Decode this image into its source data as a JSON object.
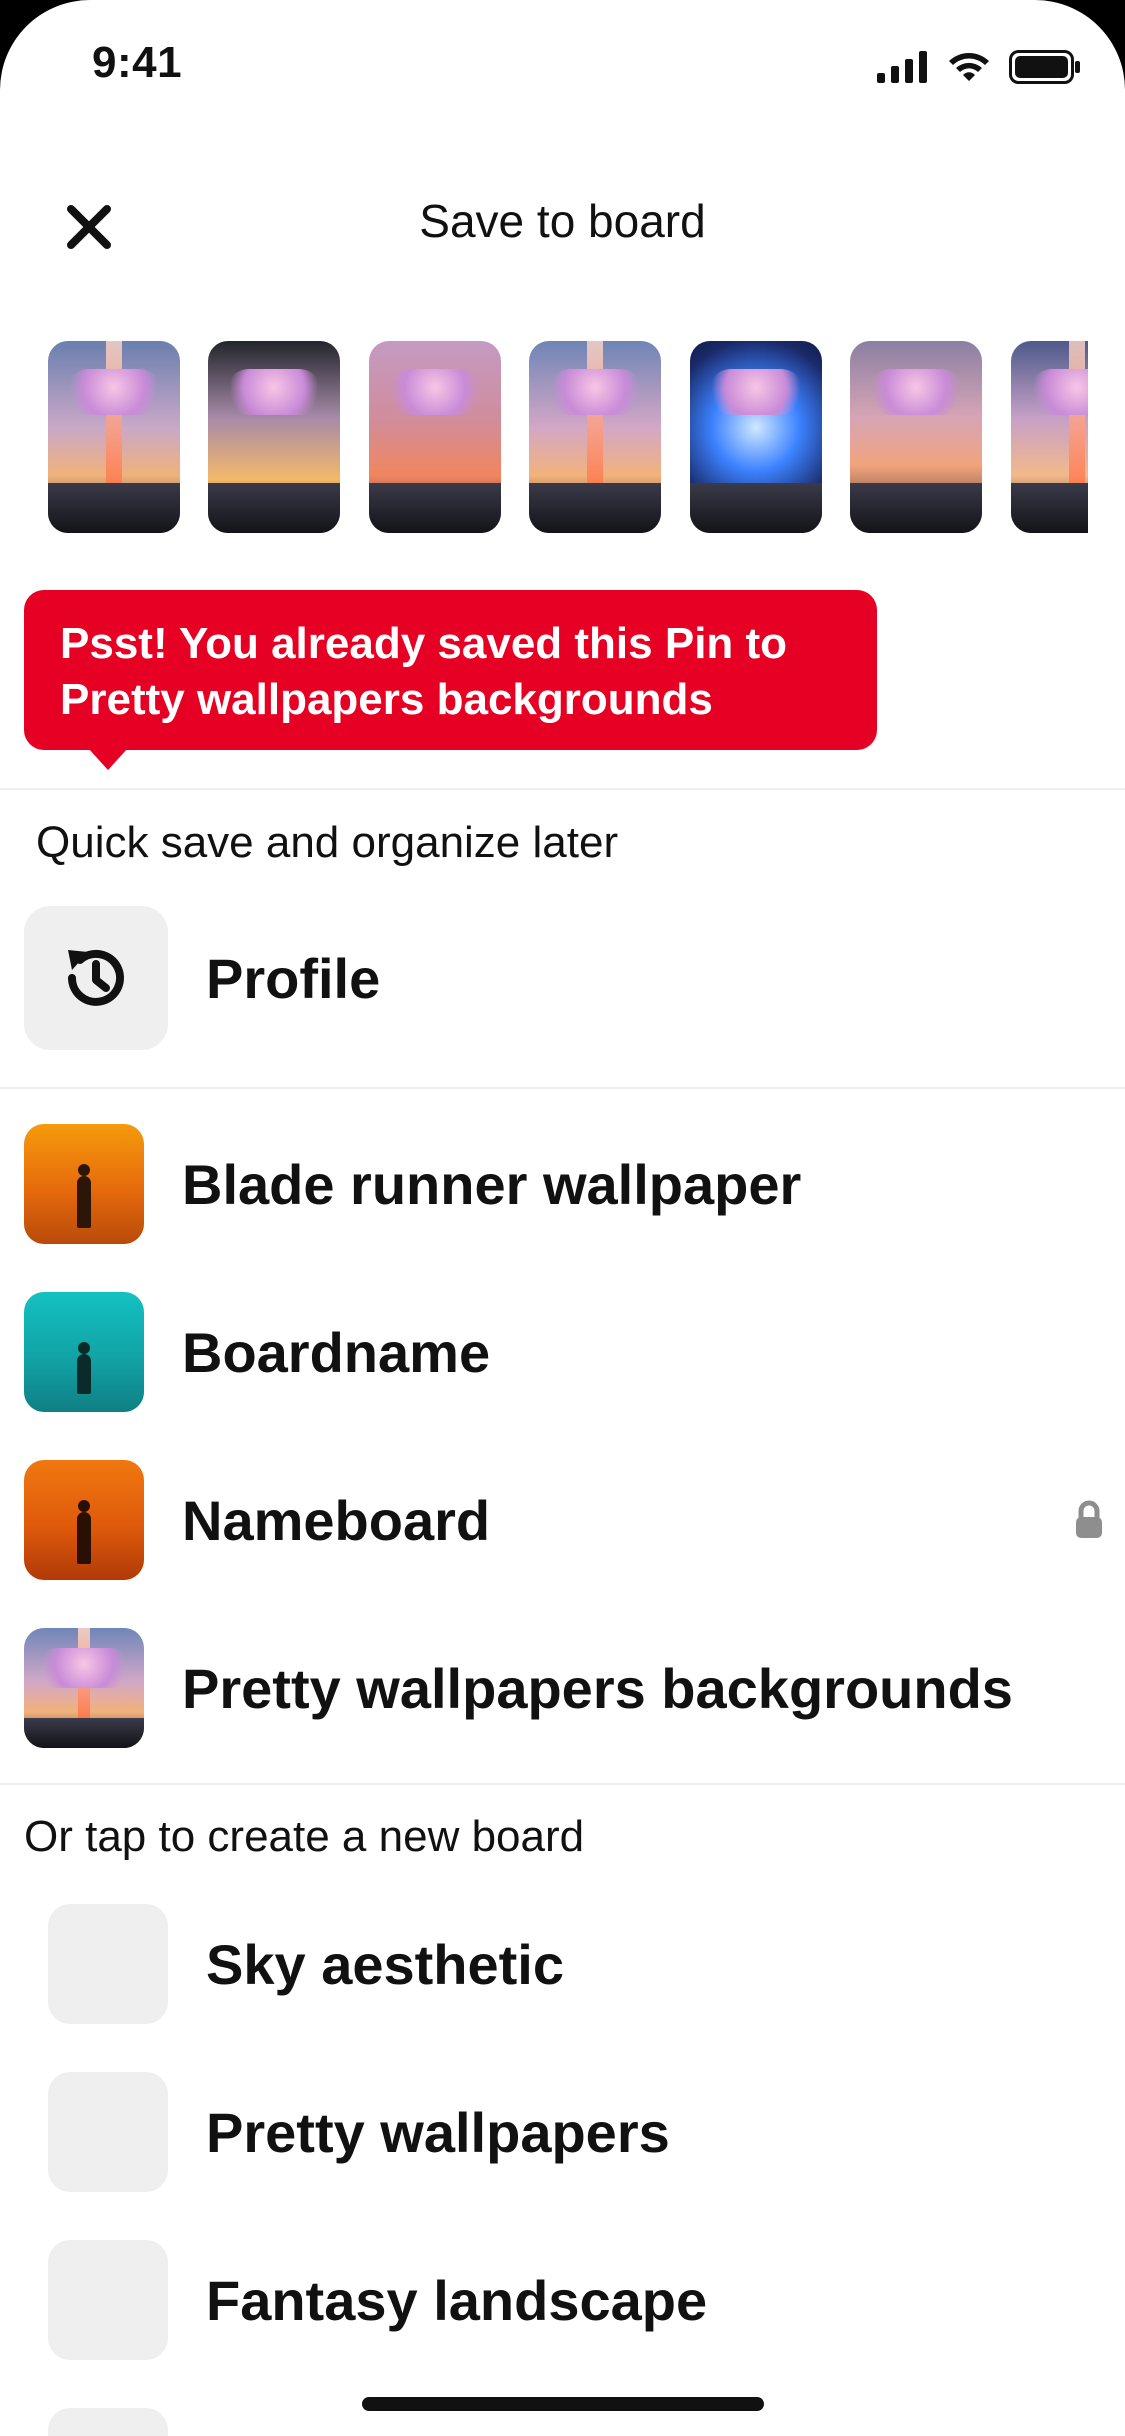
{
  "status_bar": {
    "time": "9:41",
    "icons": [
      "signal-icon",
      "wifi-icon",
      "battery-icon"
    ]
  },
  "header": {
    "title": "Save to board",
    "close_icon": "close-icon"
  },
  "thumbnails": [
    {
      "name": "pin-thumbnail"
    },
    {
      "name": "pin-thumbnail"
    },
    {
      "name": "pin-thumbnail"
    },
    {
      "name": "pin-thumbnail"
    },
    {
      "name": "pin-thumbnail"
    },
    {
      "name": "pin-thumbnail"
    },
    {
      "name": "pin-thumbnail"
    }
  ],
  "tooltip": {
    "line1": "Psst! You already saved this Pin to",
    "line2": "Pretty wallpapers backgrounds",
    "color": "#e60023"
  },
  "quick_save": {
    "label": "Quick save and organize later",
    "profile_label": "Profile",
    "profile_icon": "history-icon"
  },
  "boards": [
    {
      "label": "Blade runner wallpaper",
      "secret": false
    },
    {
      "label": "Boardname",
      "secret": false
    },
    {
      "label": "Nameboard",
      "secret": true
    },
    {
      "label": "Pretty wallpapers backgrounds",
      "secret": false
    }
  ],
  "new_board_section": {
    "label": "Or tap to create a new board",
    "suggestions": [
      {
        "label": "Sky aesthetic"
      },
      {
        "label": "Pretty wallpapers"
      },
      {
        "label": "Fantasy landscape"
      }
    ]
  }
}
